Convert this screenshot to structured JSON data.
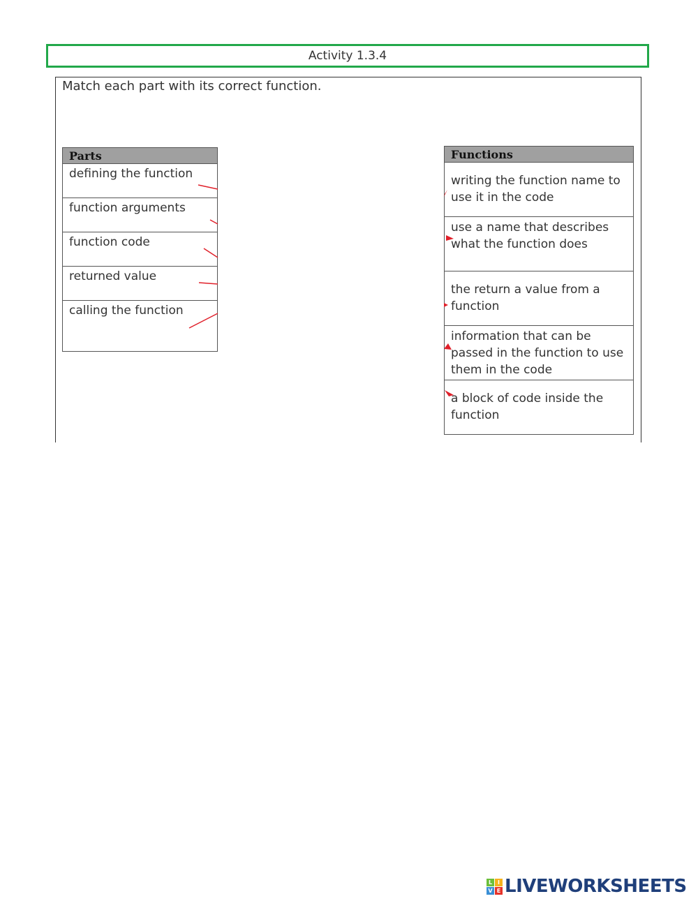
{
  "header": {
    "title": "Activity 1.3.4"
  },
  "instruction": "Match each part with its correct function.",
  "parts": {
    "header": "Parts",
    "items": [
      "defining the function",
      "function arguments",
      "function code",
      "returned value",
      "calling the function"
    ]
  },
  "functions": {
    "header": "Functions",
    "items": [
      "writing the function name to use it in the code",
      "use a name that describes what the function does",
      "the return a value from a function",
      "information that can be passed in the function to use them in the code",
      "a block of code inside the function"
    ]
  },
  "colors": {
    "title_border": "#22a84a",
    "match_line": "#e0202a",
    "logo_text": "#1f3f7a"
  },
  "logo": {
    "text": "LIVEWORKSHEETS",
    "letters": [
      "L",
      "I",
      "V",
      "E"
    ],
    "letter_colors": [
      "#6bbf3a",
      "#f5b21c",
      "#3a8fd6",
      "#e6332a"
    ]
  }
}
